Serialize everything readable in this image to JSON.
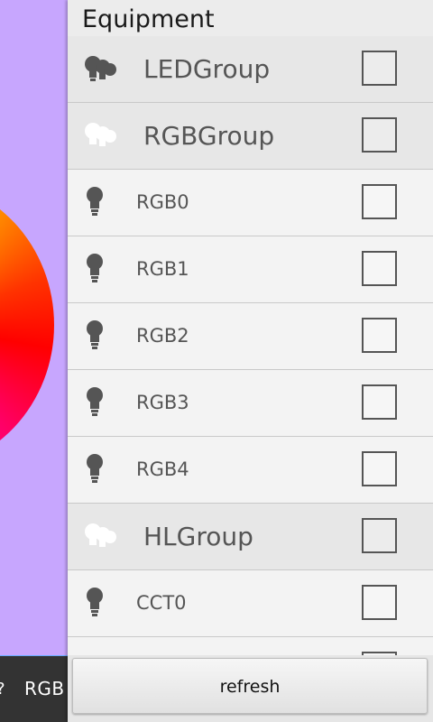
{
  "drawer": {
    "title": "Equipment",
    "rows": [
      {
        "type": "group",
        "label": "LEDGroup",
        "icon": "bulbs-group-icon",
        "icon_color": "#555555"
      },
      {
        "type": "group",
        "label": "RGBGroup",
        "icon": "bulbs-group-icon",
        "icon_color": "#ffffff"
      },
      {
        "type": "item",
        "label": "RGB0",
        "icon": "bulb-icon"
      },
      {
        "type": "item",
        "label": "RGB1",
        "icon": "bulb-icon"
      },
      {
        "type": "item",
        "label": "RGB2",
        "icon": "bulb-icon"
      },
      {
        "type": "item",
        "label": "RGB3",
        "icon": "bulb-icon"
      },
      {
        "type": "item",
        "label": "RGB4",
        "icon": "bulb-icon"
      },
      {
        "type": "group",
        "label": "HLGroup",
        "icon": "bulbs-group-icon",
        "icon_color": "#ffffff"
      },
      {
        "type": "item",
        "label": "CCT0",
        "icon": "bulb-icon"
      },
      {
        "type": "item",
        "label": "",
        "icon": "bulb-icon"
      }
    ],
    "refresh_label": "refresh"
  },
  "background": {
    "bottom_label": "RGB",
    "accent": "#c7a6fe"
  }
}
